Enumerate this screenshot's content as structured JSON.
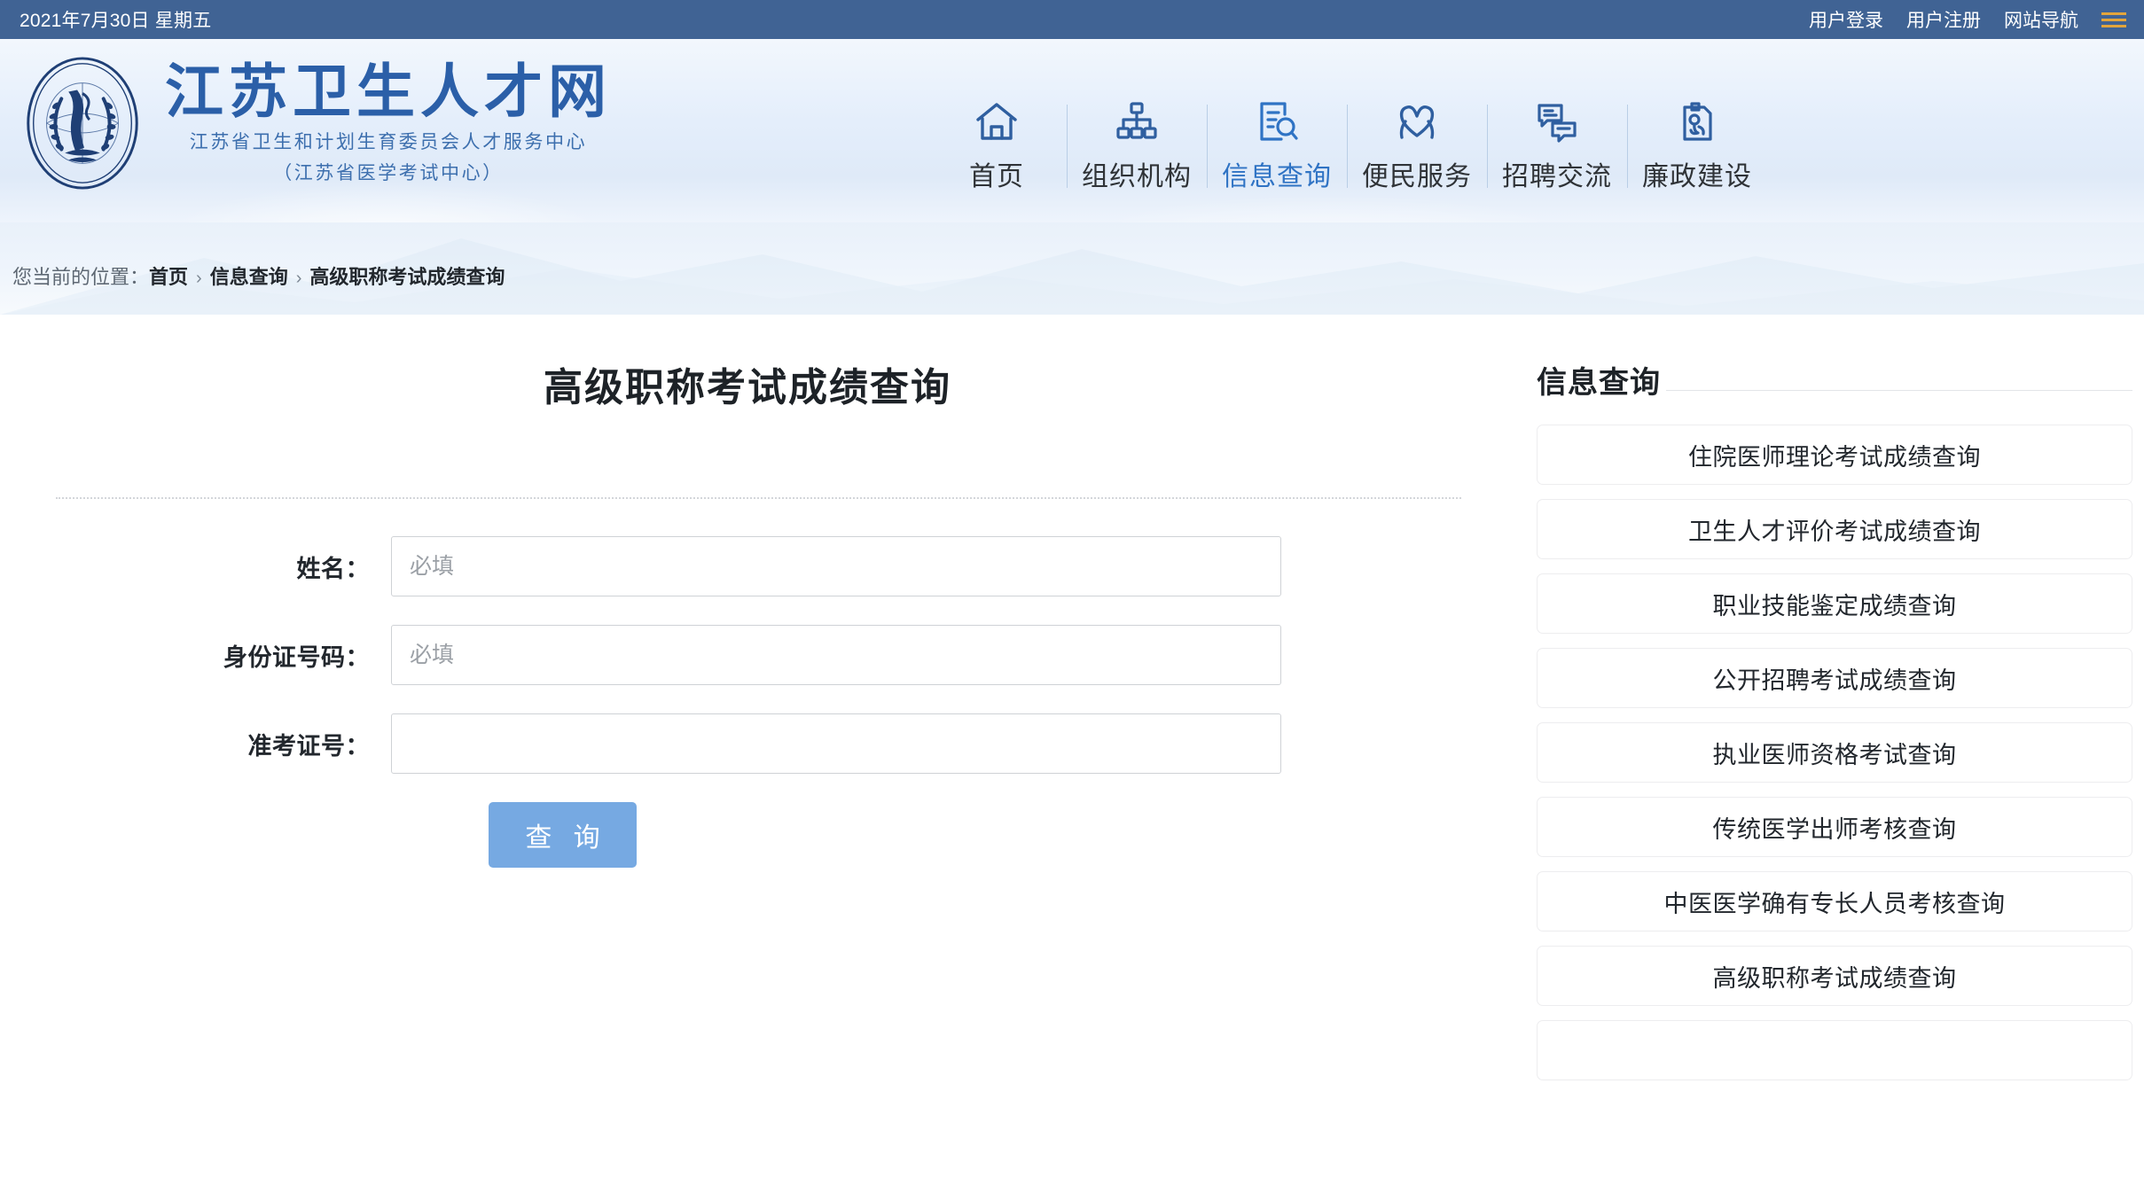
{
  "topbar": {
    "date": "2021年7月30日 星期五",
    "links": [
      "用户登录",
      "用户注册",
      "网站导航"
    ],
    "menu_icon": "hamburger-icon",
    "bg_color": "#406394",
    "menu_icon_color": "#e2a53c"
  },
  "header": {
    "logo_icon": "jiangsu-health-seal-logo",
    "title": "江苏卫生人才网",
    "subtitle1": "江苏省卫生和计划生育委员会人才服务中心",
    "subtitle2": "（江苏省医学考试中心）",
    "title_color": "#2b5fa8",
    "nav": [
      {
        "label": "首页",
        "icon": "home-icon",
        "active": false
      },
      {
        "label": "组织机构",
        "icon": "org-chart-icon",
        "active": false
      },
      {
        "label": "信息查询",
        "icon": "document-search-icon",
        "active": true
      },
      {
        "label": "便民服务",
        "icon": "heart-hands-icon",
        "active": false
      },
      {
        "label": "招聘交流",
        "icon": "chat-bubbles-icon",
        "active": false
      },
      {
        "label": "廉政建设",
        "icon": "clipboard-seal-icon",
        "active": false
      }
    ],
    "active_color": "#2f73c4"
  },
  "breadcrumb": {
    "label": "您当前的位置：",
    "items": [
      "首页",
      "信息查询",
      "高级职称考试成绩查询"
    ],
    "separator": "›"
  },
  "main": {
    "title": "高级职称考试成绩查询",
    "fields": [
      {
        "label": "姓名：",
        "value": "",
        "placeholder": "必填",
        "name": "name-field"
      },
      {
        "label": "身份证号码：",
        "value": "",
        "placeholder": "必填",
        "name": "id-number-field"
      },
      {
        "label": "准考证号：",
        "value": "",
        "placeholder": "",
        "name": "admission-ticket-field"
      }
    ],
    "submit_label": "查 询",
    "submit_color": "#76a9e2"
  },
  "sidebar": {
    "title": "信息查询",
    "items": [
      "住院医师理论考试成绩查询",
      "卫生人才评价考试成绩查询",
      "职业技能鉴定成绩查询",
      "公开招聘考试成绩查询",
      "执业医师资格考试查询",
      "传统医学出师考核查询",
      "中医医学确有专长人员考核查询",
      "高级职称考试成绩查询",
      ""
    ]
  }
}
